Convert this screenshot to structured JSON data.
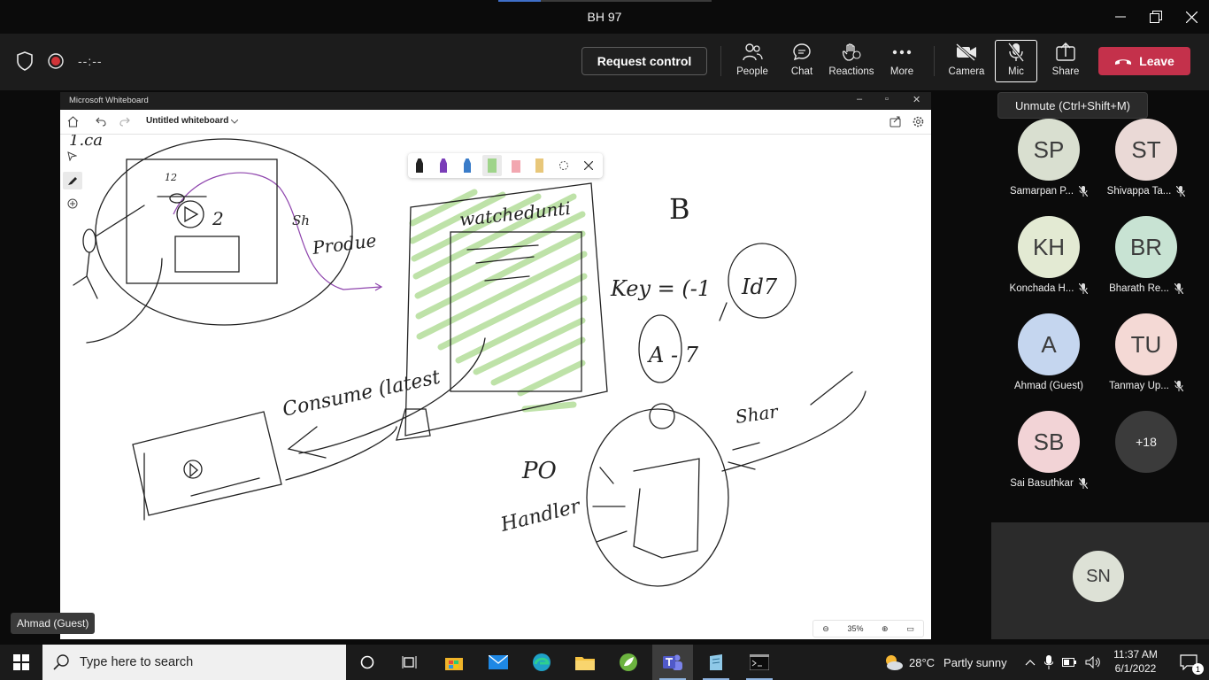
{
  "window": {
    "title": "BH 97",
    "load_progress": 0.2
  },
  "toolbar": {
    "timer": "--:--",
    "request_control": "Request control",
    "buttons": {
      "people": "People",
      "chat": "Chat",
      "reactions": "Reactions",
      "more": "More",
      "camera": "Camera",
      "mic": "Mic",
      "share": "Share"
    },
    "leave": "Leave",
    "mic_tooltip": "Unmute (Ctrl+Shift+M)"
  },
  "whiteboard": {
    "app_title": "Microsoft Whiteboard",
    "board_name": "Untitled whiteboard",
    "zoom": "35%",
    "sketch_text": {
      "top_left": "1.ca",
      "num_12": "12",
      "num_2": "2",
      "sh": "Sh",
      "produce": "Produe",
      "watched": "watchedunti",
      "b": "B",
      "key": "Key = (-1",
      "id7": "Id7",
      "a7": "A - 7",
      "consume": "Consume (latest",
      "po": "PO",
      "handler": "Handler",
      "share": "Shar"
    }
  },
  "participants": [
    {
      "initials": "SP",
      "name": "Samarpan P...",
      "color": "#d9dfd0",
      "muted": true
    },
    {
      "initials": "ST",
      "name": "Shivappa Ta...",
      "color": "#ead9d6",
      "muted": true
    },
    {
      "initials": "KH",
      "name": "Konchada H...",
      "color": "#e3ead3",
      "muted": true
    },
    {
      "initials": "BR",
      "name": "Bharath Re...",
      "color": "#c8e3d3",
      "muted": true
    },
    {
      "initials": "A",
      "name": "Ahmad (Guest)",
      "color": "#c5d6ef",
      "muted": false
    },
    {
      "initials": "TU",
      "name": "Tanmay Up...",
      "color": "#f4d9d5",
      "muted": true
    },
    {
      "initials": "SB",
      "name": "Sai Basuthkar",
      "color": "#f2d3d6",
      "muted": true
    },
    {
      "initials": "+18",
      "name": "",
      "color": "#3b3b3b",
      "muted": false
    }
  ],
  "self": {
    "initials": "SN",
    "color": "#dde1d6"
  },
  "guest_label": "Ahmad (Guest)",
  "taskbar": {
    "search_placeholder": "Type here to search",
    "weather_temp": "28°C",
    "weather_desc": "Partly sunny",
    "time": "11:37 AM",
    "date": "6/1/2022",
    "notification_count": "1"
  }
}
